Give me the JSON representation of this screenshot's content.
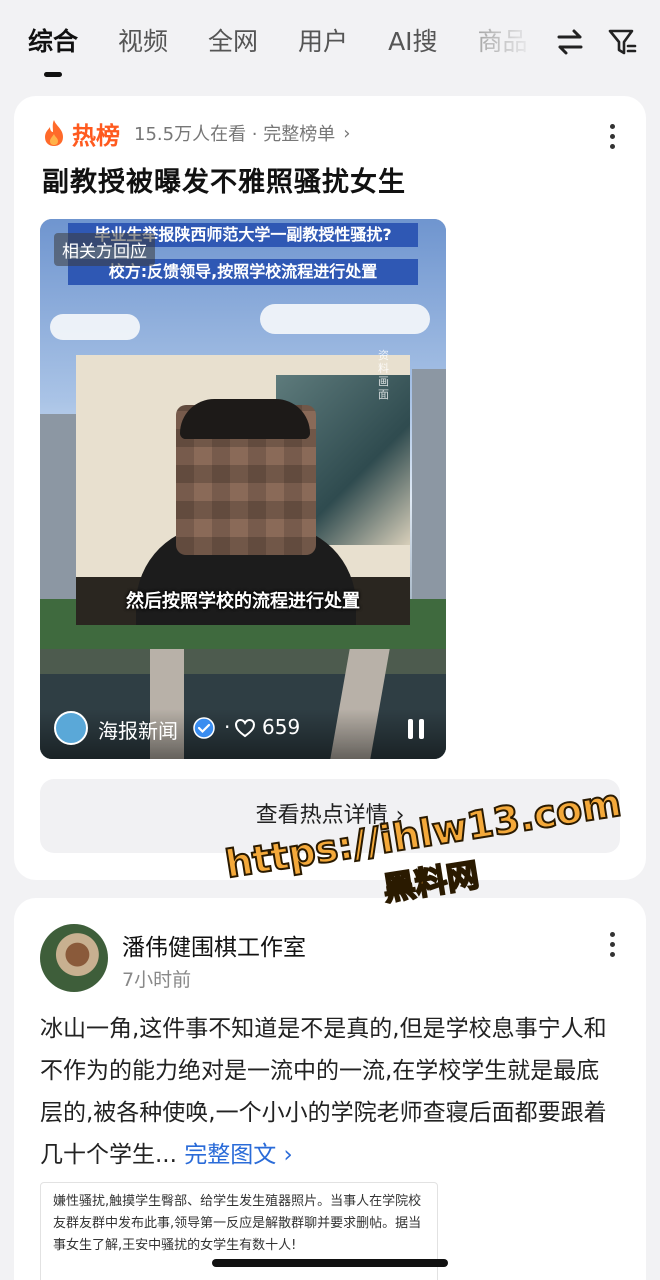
{
  "tabs": [
    "综合",
    "视频",
    "全网",
    "用户",
    "AI搜",
    "商品"
  ],
  "hot": {
    "title": "热榜",
    "meta": "15.5万人在看 · 完整榜单",
    "headline": "副教授被曝发不雅照骚扰女生"
  },
  "video": {
    "banner_line1": "毕业生举报陕西师范大学一副教授性骚扰?",
    "banner_line2": "校方:反馈领导,按照学校流程进行处置",
    "tag": "相关方回应",
    "subtitle": "然后按照学校的流程进行处置",
    "side_watermark": "资料画面",
    "author": "海报新闻",
    "separator": "·",
    "likes": "659"
  },
  "detail_button": "查看热点详情",
  "post": {
    "author": "潘伟健围棋工作室",
    "time": "7小时前",
    "body": "冰山一角,这件事不知道是不是真的,但是学校息事宁人和不作为的能力绝对是一流中的一流,在学校学生就是最底层的,被各种使唤,一个小小的学院老师查寝后面都要跟着几十个学生...",
    "more": "完整图文",
    "image_text": "嫌性骚扰,触摸学生臀部、给学生发生殖器照片。当事人在学院校友群友群中发布此事,领导第一反应是解散群聊并要求删帖。据当事女生了解,王安中骚扰的女学生有数十人!"
  },
  "watermark": {
    "line1": "https://ihlw13.com",
    "line2": "黑料网"
  },
  "colors": {
    "hot_accent": "#ff5a1f",
    "link": "#2a6bd8",
    "watermark": "#f4a93a"
  }
}
